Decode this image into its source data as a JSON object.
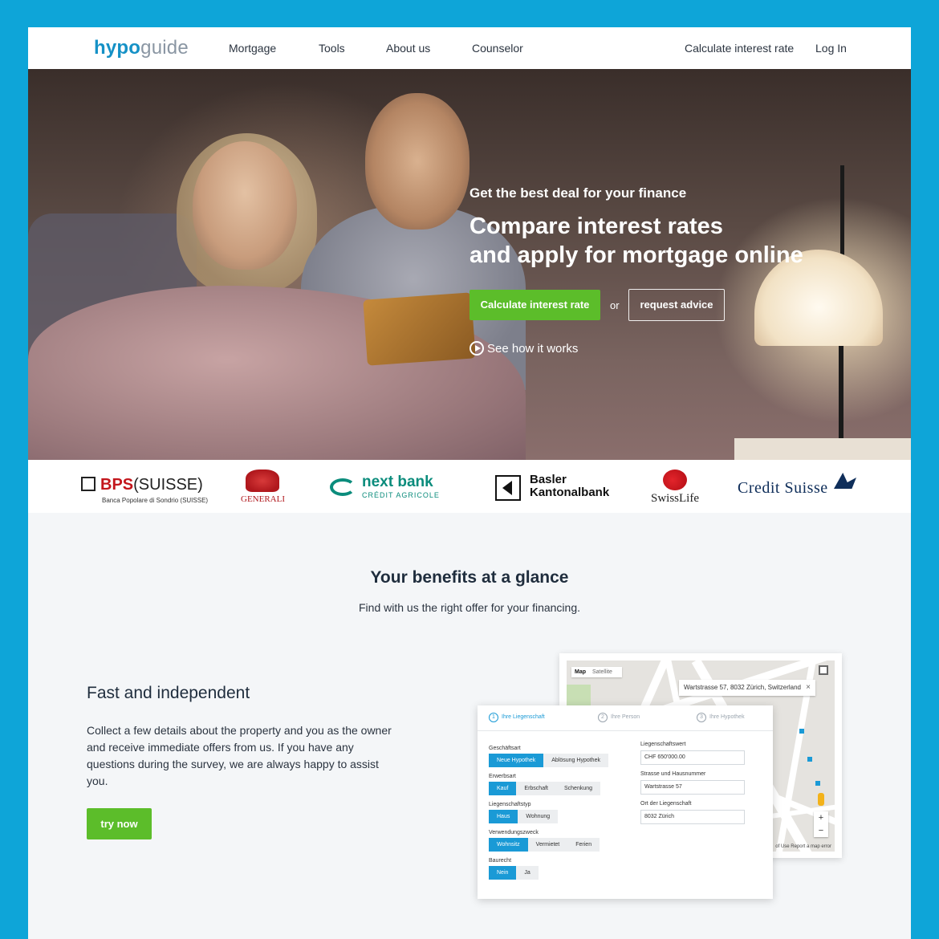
{
  "nav": {
    "logo_part1": "hypo",
    "logo_part2": "guide",
    "items": [
      "Mortgage",
      "Tools",
      "About us",
      "Counselor"
    ],
    "cta": "Calculate interest rate",
    "login": "Log In"
  },
  "hero": {
    "kicker": "Get the best deal for your finance",
    "title_line1": "Compare interest rates",
    "title_line2": "and apply for mortgage online",
    "primary_button": "Calculate interest rate",
    "or_text": "or",
    "secondary_button": "request advice",
    "video_link": "See how it works"
  },
  "partners": {
    "bps_name": "BPS",
    "bps_suffix": "(SUISSE)",
    "bps_sub": "Banca Popolare di Sondrio (SUISSE)",
    "generali": "GENERALI",
    "nextbank_name": "next bank",
    "nextbank_sub": "CRÉDIT AGRICOLE",
    "basler_line1": "Basler",
    "basler_line2": "Kantonalbank",
    "swisslife": "SwissLife",
    "creditsuisse": "Credit Suisse"
  },
  "benefits": {
    "title": "Your benefits at a glance",
    "subtitle": "Find with us the right offer for your financing."
  },
  "feature": {
    "title": "Fast and independent",
    "text": "Collect a few details about the property and you as the owner and receive immediate offers from us. If you have any questions during the survey, we are always happy to assist you.",
    "button": "try now"
  },
  "map": {
    "tab_map": "Map",
    "tab_satellite": "Satellite",
    "search_value": "Wartstrasse 57, 8032 Zürich, Switzerland",
    "close": "×",
    "zoom_in": "+",
    "zoom_out": "−",
    "footer": "of Use   Report a map error"
  },
  "form": {
    "steps": [
      "Ihre Liegenschaft",
      "Ihre Person",
      "Ihre Hypothek"
    ],
    "step_numbers": [
      "1",
      "2",
      "3"
    ],
    "geschaeftsart_label": "Geschäftsart",
    "geschaeftsart_options": [
      "Neue Hypothek",
      "Ablösung Hypothek"
    ],
    "erwerbsart_label": "Erwerbsart",
    "erwerbsart_options": [
      "Kauf",
      "Erbschaft",
      "Schenkung"
    ],
    "liegenschaftstyp_label": "Liegenschaftstyp",
    "liegenschaftstyp_options": [
      "Haus",
      "Wohnung"
    ],
    "verwendungszweck_label": "Verwendungszweck",
    "verwendungszweck_options": [
      "Wohnsitz",
      "Vermietet",
      "Ferien"
    ],
    "baurecht_label": "Baurecht",
    "baurecht_options": [
      "Nein",
      "Ja"
    ],
    "liegenschaftswert_label": "Liegenschaftswert",
    "liegenschaftswert_value": "CHF   650'000.00",
    "strasse_label": "Strasse und Hausnummer",
    "strasse_value": "Wartstrasse 57",
    "ort_label": "Ort der Liegenschaft",
    "ort_value": "8032 Zürich"
  },
  "colors": {
    "page_background": "#0ea5d8",
    "brand_blue": "#1591c6",
    "cta_green": "#5cbd2a",
    "form_active": "#1a9ad6"
  }
}
